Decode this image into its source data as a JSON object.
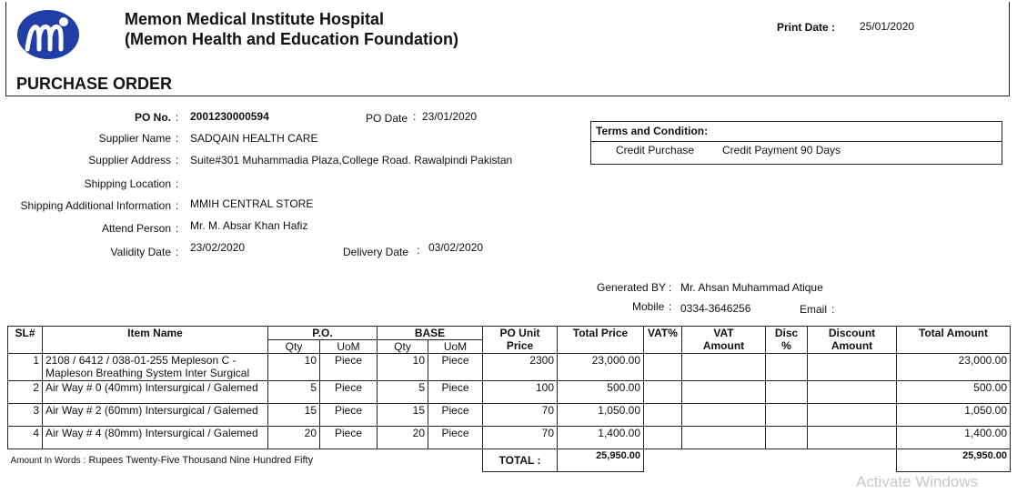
{
  "header": {
    "hospital_name": "Memon Medical Institute Hospital",
    "foundation": "(Memon Health and Education Foundation)",
    "print_date_label": "Print Date :",
    "print_date": "25/01/2020",
    "title": "PURCHASE ORDER",
    "logo_color": "#1f3fa6"
  },
  "po": {
    "po_no_label": "PO No.",
    "po_no": "2001230000594",
    "po_date_label": "PO Date",
    "po_date": "23/01/2020",
    "supplier_name_label": "Supplier Name",
    "supplier_name": "SADQAIN HEALTH CARE",
    "supplier_address_label": "Supplier Address",
    "supplier_address": "Suite#301 Muhammadia Plaza,College Road. Rawalpindi Pakistan",
    "shipping_location_label": "Shipping Location",
    "shipping_location": "",
    "shipping_additional_label": "Shipping Additional Information",
    "shipping_additional": "MMIH CENTRAL STORE",
    "attend_person_label": "Attend Person",
    "attend_person": "Mr. M. Absar Khan Hafiz",
    "validity_date_label": "Validity Date",
    "validity_date": "23/02/2020",
    "delivery_date_label": "Delivery Date",
    "delivery_date": "03/02/2020",
    "colon": ":"
  },
  "terms": {
    "title": "Terms and Condition:",
    "col1": "Credit Purchase",
    "col2": "Credit Payment 90 Days"
  },
  "generated": {
    "generated_by_label": "Generated BY",
    "generated_by": "Mr. Ahsan Muhammad Atique",
    "mobile_label": "Mobile",
    "mobile": "0334-3646256",
    "email_label": "Email",
    "email": ""
  },
  "table": {
    "headers": {
      "sl": "SL#",
      "item_name": "Item Name",
      "po": "P.O.",
      "base": "BASE",
      "qty": "Qty",
      "uom": "UoM",
      "po_unit_price_1": "PO Unit",
      "po_unit_price_2": "Price",
      "total_price": "Total Price",
      "vat_pct": "VAT%",
      "vat_amount_1": "VAT",
      "vat_amount_2": "Amount",
      "disc_pct": "Disc %",
      "discount_amount_1": "Discount",
      "discount_amount_2": "Amount",
      "total_amount": "Total Amount"
    },
    "rows": [
      {
        "sl": "1",
        "item": "2108 / 6412 / 038-01-255 Mepleson C - Mapleson Breathing System Inter Surgical",
        "po_qty": "10",
        "po_uom": "Piece",
        "base_qty": "10",
        "base_uom": "Piece",
        "unit_price": "2300",
        "total_price": "23,000.00",
        "vat_pct": "",
        "vat_amount": "",
        "disc_pct": "",
        "discount_amount": "",
        "total_amount": "23,000.00"
      },
      {
        "sl": "2",
        "item": "Air Way # 0 (40mm) Intersurgical / Galemed",
        "po_qty": "5",
        "po_uom": "Piece",
        "base_qty": "5",
        "base_uom": "Piece",
        "unit_price": "100",
        "total_price": "500.00",
        "vat_pct": "",
        "vat_amount": "",
        "disc_pct": "",
        "discount_amount": "",
        "total_amount": "500.00"
      },
      {
        "sl": "3",
        "item": "Air Way # 2 (60mm) Intersurgical / Galemed",
        "po_qty": "15",
        "po_uom": "Piece",
        "base_qty": "15",
        "base_uom": "Piece",
        "unit_price": "70",
        "total_price": "1,050.00",
        "vat_pct": "",
        "vat_amount": "",
        "disc_pct": "",
        "discount_amount": "",
        "total_amount": "1,050.00"
      },
      {
        "sl": "4",
        "item": "Air Way # 4 (80mm) Intersurgical / Galemed",
        "po_qty": "20",
        "po_uom": "Piece",
        "base_qty": "20",
        "base_uom": "Piece",
        "unit_price": "70",
        "total_price": "1,400.00",
        "vat_pct": "",
        "vat_amount": "",
        "disc_pct": "",
        "discount_amount": "",
        "total_amount": "1,400.00"
      }
    ],
    "amount_in_words_label": "Amount In Words :",
    "amount_in_words": "Rupees Twenty-Five Thousand Nine Hundred Fifty",
    "total_label": "TOTAL :",
    "total_price": "25,950.00",
    "total_amount": "25,950.00"
  },
  "watermark": "Activate Windows"
}
